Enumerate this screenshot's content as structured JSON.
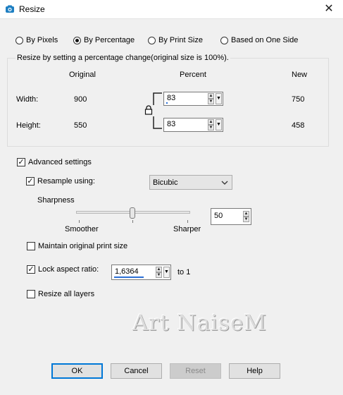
{
  "window": {
    "title": "Resize",
    "close_glyph": "✕"
  },
  "resize_modes": [
    {
      "label": "By Pixels",
      "selected": false
    },
    {
      "label": "By Percentage",
      "selected": true
    },
    {
      "label": "By Print Size",
      "selected": false
    },
    {
      "label": "Based on One Side",
      "selected": false
    }
  ],
  "percent_group": {
    "caption": "Resize by setting a percentage change(original size is 100%).",
    "col_original": "Original",
    "col_percent": "Percent",
    "col_new": "New",
    "width": {
      "label": "Width:",
      "original": "900",
      "percent": "83",
      "new": "750"
    },
    "height": {
      "label": "Height:",
      "original": "550",
      "percent": "83",
      "new": "458"
    },
    "link_icon": "lock-icon"
  },
  "advanced": {
    "label": "Advanced settings",
    "checked": true,
    "resample": {
      "label": "Resample using:",
      "checked": true,
      "value": "Bicubic"
    },
    "sharpness": {
      "label": "Sharpness",
      "left_label": "Smoother",
      "right_label": "Sharper",
      "value": "50",
      "level": 0.5
    },
    "maintain_print": {
      "label": "Maintain original print size",
      "checked": false
    },
    "lock_aspect": {
      "label": "Lock aspect ratio:",
      "checked": true,
      "value": "1,6364",
      "suffix": "to 1"
    },
    "resize_layers": {
      "label": "Resize all layers",
      "checked": false
    }
  },
  "watermark": "Art NaiseM",
  "buttons": {
    "ok": "OK",
    "cancel": "Cancel",
    "reset": "Reset",
    "help": "Help"
  },
  "colors": {
    "accent": "#0078d7",
    "icon": "#1e7fc2"
  }
}
